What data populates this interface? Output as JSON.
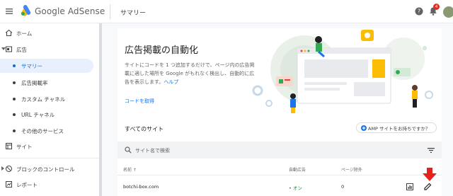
{
  "header": {
    "brand": "Google AdSense",
    "page_title": "サマリー",
    "notification_count": "4",
    "avatar_color": "#8a9a70"
  },
  "sidebar": {
    "items": [
      {
        "label": "ホーム",
        "icon": "home-icon"
      },
      {
        "label": "広告",
        "icon": "ads-icon"
      },
      {
        "label": "サマリー",
        "active": true
      },
      {
        "label": "広告掲載率"
      },
      {
        "label": "カスタム チャネル"
      },
      {
        "label": "URL チャネル"
      },
      {
        "label": "その他のサービス"
      },
      {
        "label": "サイト",
        "icon": "sites-icon"
      },
      {
        "label": "ブロックのコントロール",
        "icon": "block-icon"
      },
      {
        "label": "レポート",
        "icon": "reports-icon"
      }
    ]
  },
  "hero": {
    "title": "広告掲載の自動化",
    "description": "サイトにコードを 1 つ追加するだけで、ページ内の広告掲載に適した場所を Google がもれなく検出し、自動的に広告を表示します。",
    "help_link": "ヘルプ",
    "get_code": "コードを取得"
  },
  "sites": {
    "title": "すべてのサイト",
    "amp_button": "AMP サイトをお持ちですか？",
    "search_placeholder": "サイト名で検索",
    "columns": [
      "名前",
      "自動広告",
      "ページ除外"
    ],
    "rows": [
      {
        "name": "botchi-box.com",
        "auto_ads": "オン",
        "excluded": "0"
      }
    ]
  },
  "colors": {
    "accent": "#1a73e8",
    "active_bg": "#e8f0fe",
    "on_status": "#188038",
    "arrow": "#e8201a"
  }
}
